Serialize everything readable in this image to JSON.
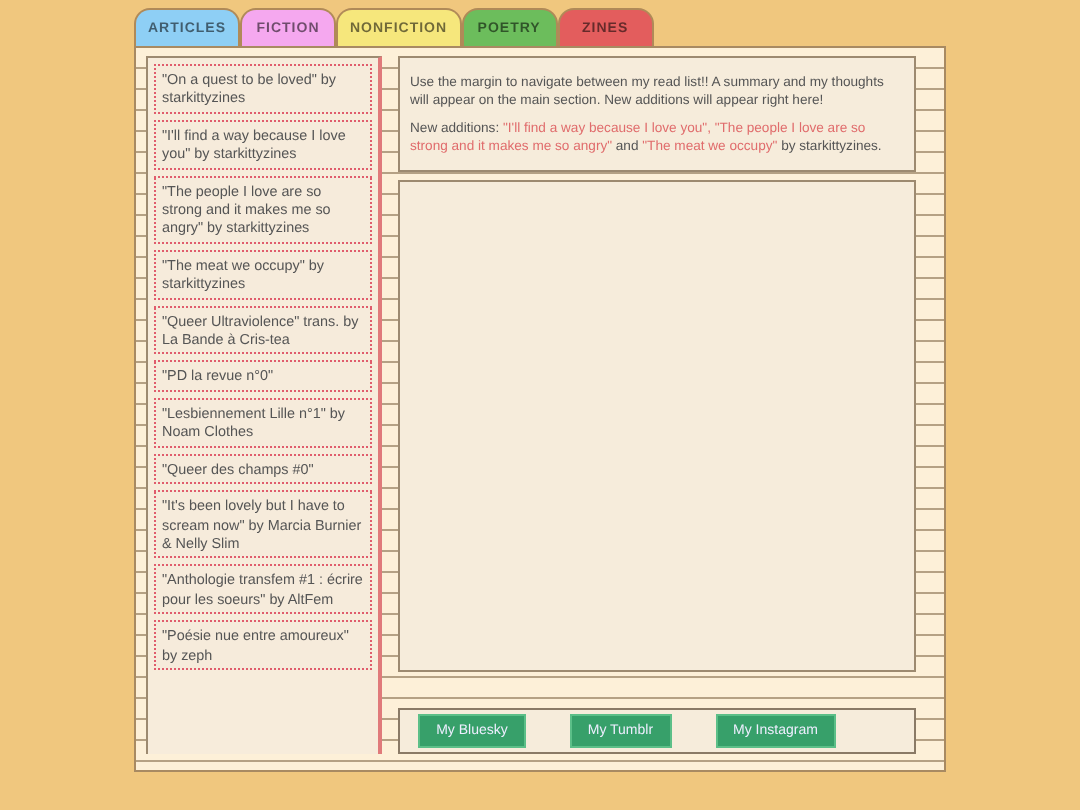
{
  "tabs": [
    {
      "label": "ARTICLES",
      "color": "#8ecff5"
    },
    {
      "label": "FICTION",
      "color": "#f5a8ef"
    },
    {
      "label": "NONFICTION",
      "color": "#f6e77c"
    },
    {
      "label": "POETRY",
      "color": "#6cbd5c"
    },
    {
      "label": "ZINES",
      "color": "#e35d5d"
    }
  ],
  "sidebar": {
    "items": [
      "\"On a quest to be loved\" by starkittyzines",
      "\"I'll find a way because I love you\" by starkittyzines",
      "\"The people I love are so strong and it makes me so angry\" by starkittyzines",
      "\"The meat we occupy\" by starkittyzines",
      "\"Queer Ultraviolence\" trans. by La Bande à Cris-tea",
      "\"PD la revue n°0\"",
      "\"Lesbiennement Lille n°1\" by Noam Clothes",
      "\"Queer des champs #0\"",
      "\"It's been lovely but I have to scream now\" by Marcia Burnier & Nelly Slim",
      "\"Anthologie transfem #1 : écrire pour les soeurs\" by AltFem",
      "\"Poésie nue entre amoureux\" by zeph"
    ]
  },
  "intro": {
    "text": "Use the margin to navigate between my read list!! A summary and my thoughts will appear on the main section. New additions will appear right here!",
    "additions_label": "New additions:",
    "additions": [
      {
        "kind": "title",
        "text": "\"I'll find a way because I love you\","
      },
      {
        "kind": "title",
        "text": "\"The people I love are so strong and it makes me so angry\""
      },
      {
        "kind": "plain",
        "text": "and"
      },
      {
        "kind": "title",
        "text": "\"The meat we occupy\""
      },
      {
        "kind": "plain",
        "text": "by starkittyzines."
      }
    ]
  },
  "links": [
    "My Bluesky",
    "My Tumblr",
    "My Instagram"
  ]
}
